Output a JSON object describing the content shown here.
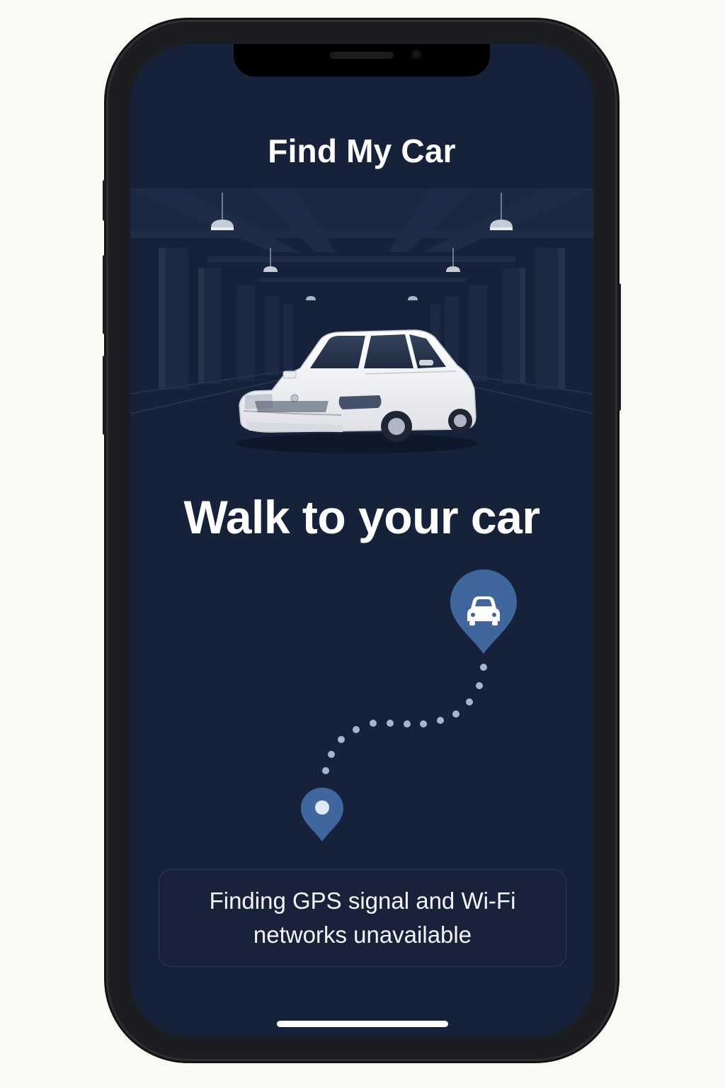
{
  "app": {
    "title": "Find My Car"
  },
  "main": {
    "headline": "Walk to your car"
  },
  "map": {
    "destination_icon": "car-pin-icon",
    "origin_icon": "location-pin-icon",
    "route_style": "dotted"
  },
  "status": {
    "message": "Finding GPS signal and Wi-Fi networks unavailable"
  },
  "colors": {
    "background": "#16223a",
    "pin": "#3f679d",
    "route_dots": "#a5b7cd",
    "text": "#ffffff"
  }
}
